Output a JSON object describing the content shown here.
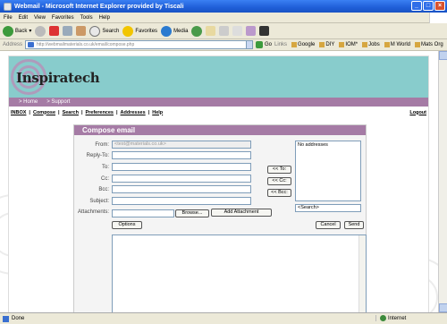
{
  "window": {
    "title": "Webmail - Microsoft Internet Explorer provided by Tiscali"
  },
  "menu": [
    "File",
    "Edit",
    "View",
    "Favorites",
    "Tools",
    "Help"
  ],
  "toolbar": {
    "back": "Back",
    "search": "Search",
    "favorites": "Favorites",
    "media": "Media"
  },
  "address": {
    "label": "Address",
    "url": "http://webmailmaterials.co.uk/email/compose.php",
    "go": "Go"
  },
  "links": {
    "label": "Links",
    "items": [
      "Google",
      "DIY",
      "IOM*",
      "Jobs",
      "M World",
      "Mats Org"
    ]
  },
  "site": {
    "logo": "Inspiratech",
    "subnav": [
      "> Home",
      "> Support"
    ],
    "nav": [
      "INBOX",
      "Compose",
      "Search",
      "Preferences",
      "Addresses",
      "Help"
    ],
    "logout": "Logout"
  },
  "compose": {
    "title": "Compose email",
    "from_label": "From:",
    "from_value": "<test@materials.co.uk>",
    "replyto_label": "Reply-To:",
    "to_label": "To:",
    "cc_label": "Cc:",
    "bcc_label": "Bcc:",
    "subject_label": "Subject:",
    "attachments_label": "Attachments:",
    "browse": "Browse...",
    "add_attachment": "Add Attachment",
    "to_btn": "<< To:",
    "cc_btn": "<< Cc:",
    "bcc_btn": "<< Bcc:",
    "no_addresses": "No addresses",
    "search_placeholder": "<Search>",
    "options": "Options",
    "cancel": "Cancel",
    "send": "Send"
  },
  "status": {
    "text": "Done",
    "zone": "Internet"
  }
}
